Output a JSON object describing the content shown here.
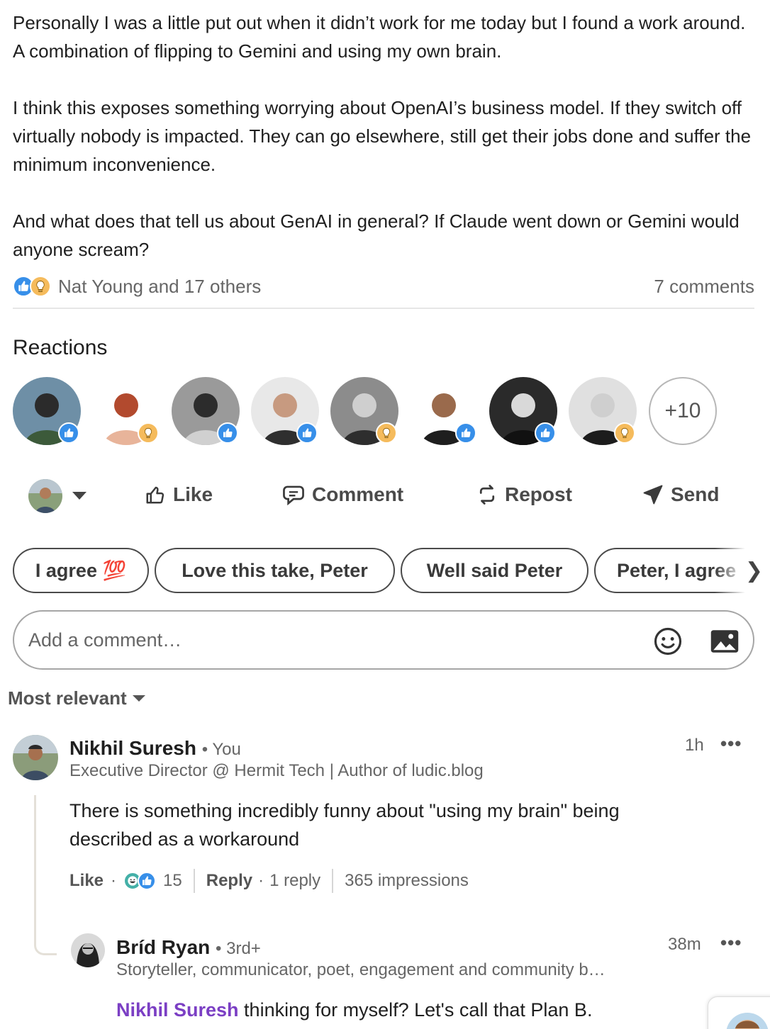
{
  "post": {
    "paragraphs": [
      "Personally I was a little put out when it didn’t work for me today but I found a work around. A combination of flipping to Gemini and using my own brain.",
      "I think this exposes something worrying about OpenAI’s business model. If they switch off virtually nobody is impacted. They can go elsewhere, still get their jobs done and suffer the minimum inconvenience.",
      "And what does that tell us about GenAI in general? If Claude went down or Gemini would anyone scream?"
    ],
    "reactors_text": "Nat Young and 17 others",
    "reaction_icons": [
      "like-icon",
      "insightful-icon"
    ],
    "comments_count": "7 comments"
  },
  "reactions": {
    "title": "Reactions",
    "avatars": [
      {
        "reaction": "like"
      },
      {
        "reaction": "insightful"
      },
      {
        "reaction": "like"
      },
      {
        "reaction": "like"
      },
      {
        "reaction": "insightful"
      },
      {
        "reaction": "like"
      },
      {
        "reaction": "like"
      },
      {
        "reaction": "insightful"
      }
    ],
    "more_label": "+10"
  },
  "actions": {
    "like": "Like",
    "comment": "Comment",
    "repost": "Repost",
    "send": "Send"
  },
  "suggestions": [
    "I agree 💯",
    "Love this take, Peter",
    "Well said Peter",
    "Peter, I agree"
  ],
  "comment_box": {
    "placeholder": "Add a comment…"
  },
  "sort": {
    "label": "Most relevant"
  },
  "comments": [
    {
      "name": "Nikhil Suresh",
      "degree": "• You",
      "headline": "Executive Director @ Hermit Tech | Author of ludic.blog",
      "time": "1h",
      "body": "There is something incredibly funny about \"using my brain\" being described as a workaround",
      "like_label": "Like",
      "reaction_count": "15",
      "reply_label": "Reply",
      "reply_count": "1 reply",
      "impressions": "365 impressions"
    },
    {
      "name": "Bríd Ryan",
      "degree": "• 3rd+",
      "headline": "Storyteller, communicator, poet, engagement and community b…",
      "time": "38m",
      "mention": "Nikhil Suresh",
      "body": " thinking for myself? Let's call that Plan B."
    }
  ],
  "colors": {
    "like": "#378fe9",
    "insightful": "#f5bb5c",
    "mention": "#7b3fc4",
    "muted_text": "#666666"
  }
}
